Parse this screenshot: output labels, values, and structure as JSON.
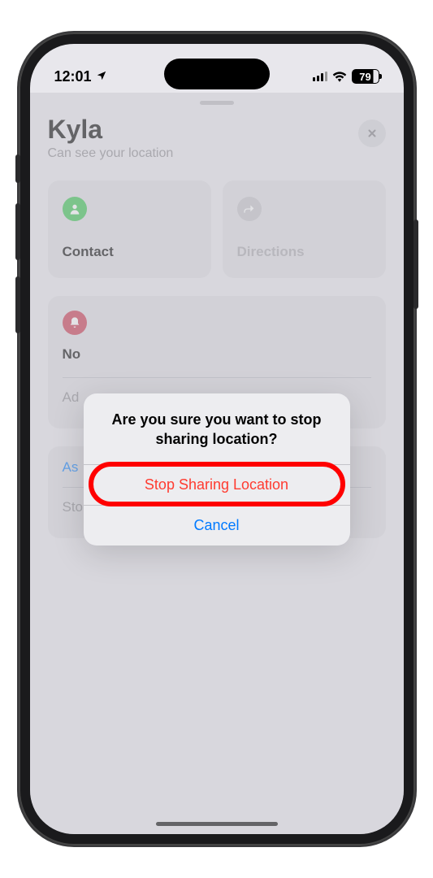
{
  "status_bar": {
    "time": "12:01",
    "battery_percent": "79"
  },
  "header": {
    "title": "Kyla",
    "subtitle": "Can see your location"
  },
  "cards": {
    "contact": {
      "label": "Contact"
    },
    "directions": {
      "label": "Directions"
    }
  },
  "notifications": {
    "title": "No",
    "add_link": "Ad",
    "ask_link": "As"
  },
  "stop_sharing": {
    "label": "Stop Sharing My Location"
  },
  "alert": {
    "title": "Are you sure you want to stop sharing location?",
    "stop_button": "Stop Sharing Location",
    "cancel_button": "Cancel"
  }
}
